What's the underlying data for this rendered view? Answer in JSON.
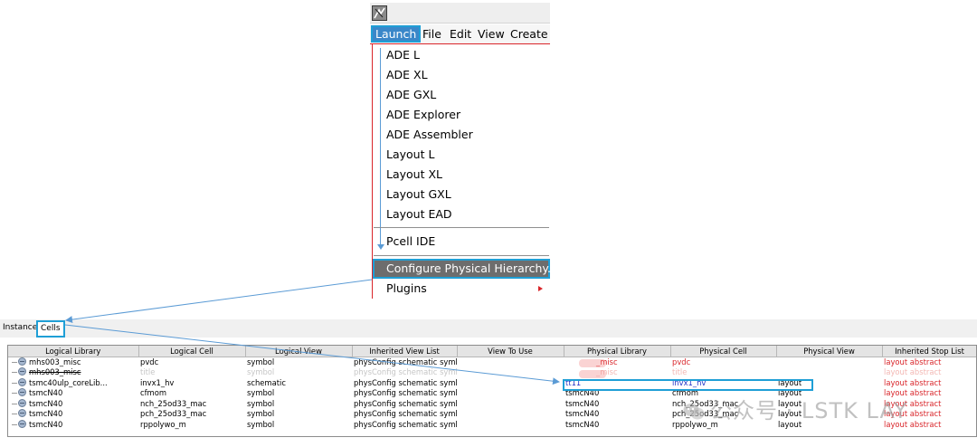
{
  "launch_menu": {
    "menubar": [
      {
        "label": "Launch",
        "active": true
      },
      {
        "label": "File"
      },
      {
        "label": "Edit"
      },
      {
        "label": "View"
      },
      {
        "label": "Create"
      }
    ],
    "items": [
      {
        "label": "ADE L"
      },
      {
        "label": "ADE XL"
      },
      {
        "label": "ADE GXL"
      },
      {
        "label": "ADE Explorer"
      },
      {
        "label": "ADE Assembler"
      },
      {
        "label": "Layout L"
      },
      {
        "label": "Layout XL"
      },
      {
        "label": "Layout GXL"
      },
      {
        "label": "Layout EAD"
      },
      {
        "label": "Pcell IDE"
      },
      {
        "label": "Configure Physical Hierarchy...",
        "highlighted": true
      },
      {
        "label": "Plugins",
        "has_submenu": true
      }
    ]
  },
  "tabs": [
    {
      "label": "Instances"
    },
    {
      "label": "Cells",
      "active": true
    }
  ],
  "table": {
    "columns": [
      "Logical Library",
      "Logical Cell",
      "Logical View",
      "Inherited View List",
      "View To Use",
      "Physical Library",
      "Physical Cell",
      "Physical View",
      "Inherited Stop List"
    ],
    "rows": [
      {
        "logical_library": "mhs003_misc",
        "logical_cell": "pvdc",
        "logical_view": "symbol",
        "inherited_view_list": "physConfig schematic symbol",
        "view_to_use": "",
        "physical_library": "_misc",
        "physical_cell": "pvdc",
        "physical_view": "",
        "inherited_stop_list": "layout abstract",
        "style": "red"
      },
      {
        "logical_library": "mhs003_misc",
        "logical_cell": "title",
        "logical_view": "symbol",
        "inherited_view_list": "physConfig schematic symbol",
        "view_to_use": "",
        "physical_library": "_misc",
        "physical_cell": "title",
        "physical_view": "",
        "inherited_stop_list": "layout abstract",
        "style": "struck"
      },
      {
        "logical_library": "tsmc40ulp_coreLib...",
        "logical_cell": "invx1_hv",
        "logical_view": "schematic",
        "inherited_view_list": "physConfig schematic symbol",
        "view_to_use": "",
        "physical_library": "tt11",
        "physical_cell": "invx1_hv",
        "physical_view": "layout",
        "inherited_stop_list": "layout abstract",
        "style": "blue"
      },
      {
        "logical_library": "tsmcN40",
        "logical_cell": "cfmom",
        "logical_view": "symbol",
        "inherited_view_list": "physConfig schematic symbol",
        "view_to_use": "",
        "physical_library": "tsmcN40",
        "physical_cell": "cfmom",
        "physical_view": "layout",
        "inherited_stop_list": "layout abstract",
        "style": "normal"
      },
      {
        "logical_library": "tsmcN40",
        "logical_cell": "nch_25od33_mac",
        "logical_view": "symbol",
        "inherited_view_list": "physConfig schematic symbol",
        "view_to_use": "",
        "physical_library": "tsmcN40",
        "physical_cell": "nch_25od33_mac",
        "physical_view": "layout",
        "inherited_stop_list": "layout abstract",
        "style": "normal"
      },
      {
        "logical_library": "tsmcN40",
        "logical_cell": "pch_25od33_mac",
        "logical_view": "symbol",
        "inherited_view_list": "physConfig schematic symbol",
        "view_to_use": "",
        "physical_library": "tsmcN40",
        "physical_cell": "pch_25od33_mac",
        "physical_view": "layout",
        "inherited_stop_list": "layout abstract",
        "style": "normal"
      },
      {
        "logical_library": "tsmcN40",
        "logical_cell": "rppolywo_m",
        "logical_view": "symbol",
        "inherited_view_list": "physConfig schematic symbol",
        "view_to_use": "",
        "physical_library": "tsmcN40",
        "physical_cell": "rppolywo_m",
        "physical_view": "layout",
        "inherited_stop_list": "layout abstract",
        "style": "normal"
      }
    ]
  },
  "watermark": {
    "text": "公众号 · LSTK LAY"
  },
  "colors": {
    "highlight_border": "#1f9fd6",
    "menu_highlight": "#6d6d6d",
    "accent_red": "#d9252a",
    "arrow_blue": "#5b9bd5",
    "link_blue": "#2233c6"
  },
  "icons": [
    "virtuoso-app-icon",
    "submenu-arrow-icon",
    "tree-node-icon",
    "wechat-icon"
  ]
}
